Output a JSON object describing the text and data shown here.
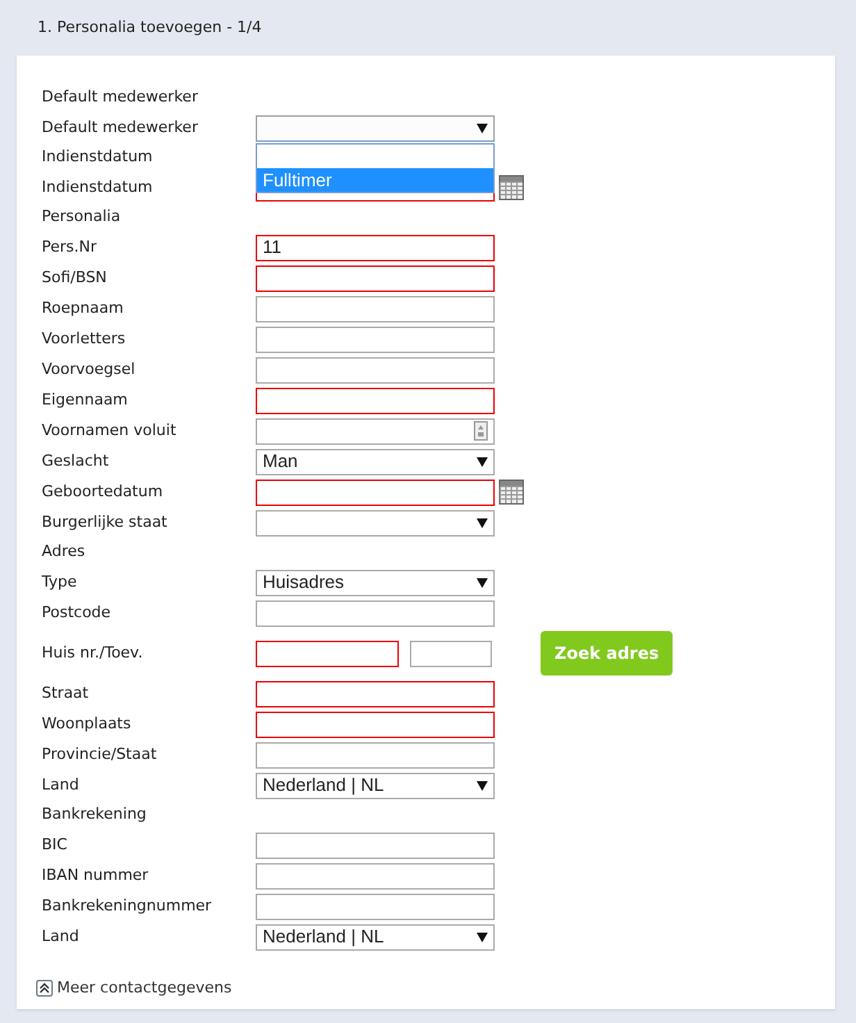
{
  "header": {
    "title": "1. Personalia toevoegen - 1/4"
  },
  "rows": [
    {
      "kind": "heading",
      "label": "Default medewerker"
    },
    {
      "kind": "select",
      "label": "Default medewerker",
      "value": "",
      "required": false,
      "expanded": true,
      "options": [
        {
          "selected": false
        },
        {
          "label": "Fulltimer",
          "selected": true
        }
      ]
    },
    {
      "kind": "heading",
      "label": "Indienstdatum"
    },
    {
      "kind": "date",
      "label": "Indienstdatum",
      "value": "",
      "required": true
    },
    {
      "kind": "heading",
      "label": "Personalia"
    },
    {
      "kind": "text",
      "label": "Pers.Nr",
      "value": "11",
      "required": true
    },
    {
      "kind": "text",
      "label": "Sofi/BSN",
      "value": "",
      "required": true
    },
    {
      "kind": "text",
      "label": "Roepnaam",
      "value": "",
      "required": false
    },
    {
      "kind": "text",
      "label": "Voorletters",
      "value": "",
      "required": false
    },
    {
      "kind": "text",
      "label": "Voorvoegsel",
      "value": "",
      "required": false
    },
    {
      "kind": "text",
      "label": "Eigennaam",
      "value": "",
      "required": true
    },
    {
      "kind": "textarea",
      "label": "Voornamen voluit",
      "value": "",
      "required": false
    },
    {
      "kind": "select",
      "label": "Geslacht",
      "value": "Man",
      "required": false
    },
    {
      "kind": "date",
      "label": "Geboortedatum",
      "value": "",
      "required": true
    },
    {
      "kind": "select",
      "label": "Burgerlijke staat",
      "value": "",
      "required": false
    },
    {
      "kind": "heading",
      "label": "Adres"
    },
    {
      "kind": "select",
      "label": "Type",
      "value": "Huisadres",
      "required": false
    },
    {
      "kind": "text",
      "label": "Postcode",
      "value": "",
      "required": false
    },
    {
      "kind": "house",
      "label": "Huis nr./Toev.",
      "value": "",
      "required": true,
      "addition": "",
      "button": "Zoek adres"
    },
    {
      "kind": "text",
      "label": "Straat",
      "value": "",
      "required": true
    },
    {
      "kind": "text",
      "label": "Woonplaats",
      "value": "",
      "required": true
    },
    {
      "kind": "text",
      "label": "Provincie/Staat",
      "value": "",
      "required": false
    },
    {
      "kind": "select",
      "label": "Land",
      "value": "Nederland | NL",
      "required": false
    },
    {
      "kind": "heading",
      "label": "Bankrekening"
    },
    {
      "kind": "text",
      "label": "BIC",
      "value": "",
      "required": false
    },
    {
      "kind": "text",
      "label": "IBAN nummer",
      "value": "",
      "required": false
    },
    {
      "kind": "text",
      "label": "Bankrekeningnummer",
      "value": "",
      "required": false
    },
    {
      "kind": "select",
      "label": "Land",
      "value": "Nederland | NL",
      "required": false
    }
  ],
  "footer_link": "Meer contactgegevens"
}
